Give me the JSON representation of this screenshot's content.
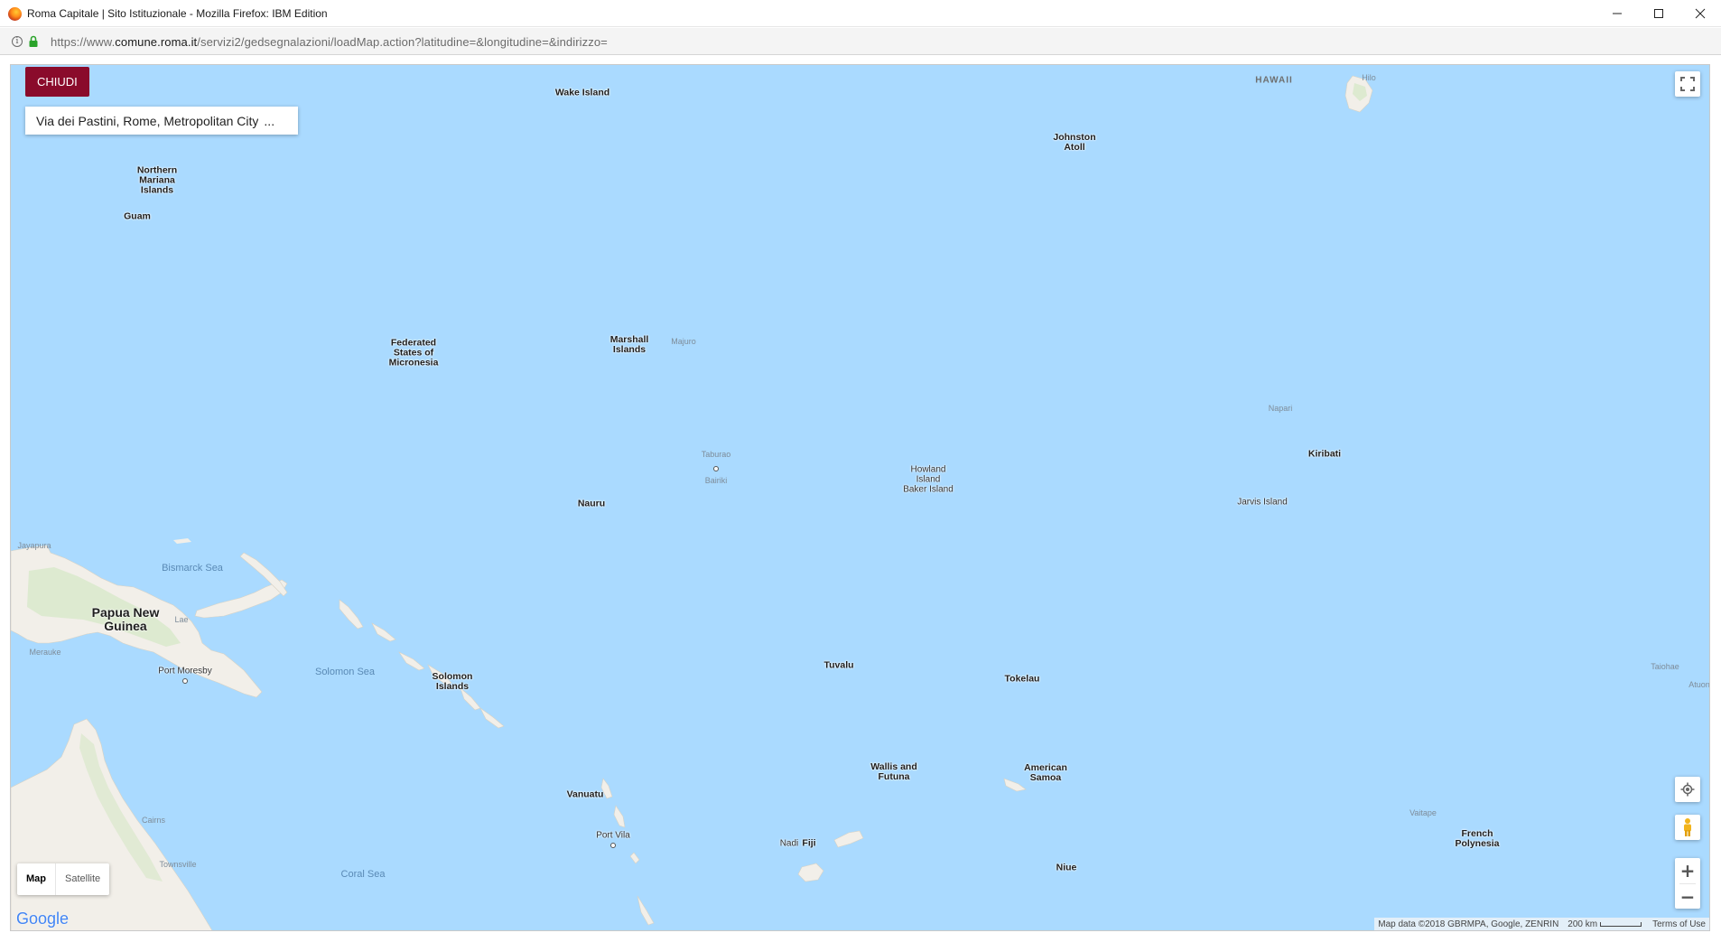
{
  "window": {
    "title": "Roma Capitale | Sito Istituzionale - Mozilla Firefox: IBM Edition"
  },
  "address_bar": {
    "url_prefix": "https://www.",
    "url_domain": "comune.roma.it",
    "url_path": "/servizi2/gedsegnalazioni/loadMap.action?latitudine=&longitudine=&indirizzo="
  },
  "toolbar": {
    "close_label": "CHIUDI",
    "address_text": "Via dei Pastini, Rome, Metropolitan City",
    "address_more": "..."
  },
  "map_type": {
    "map_label": "Map",
    "satellite_label": "Satellite"
  },
  "footer": {
    "google_logo": "Google",
    "map_data": "Map data ©2018 GBRMPA, Google, ZENRIN",
    "scale": "200 km",
    "terms": "Terms of Use"
  },
  "labels": {
    "wake_island": "Wake Island",
    "hawaii": "HAWAII",
    "hilo": "Hilo",
    "johnston_1": "Johnston",
    "johnston_2": "Atoll",
    "northern_mariana_1": "Northern",
    "northern_mariana_2": "Mariana",
    "northern_mariana_3": "Islands",
    "guam": "Guam",
    "fsm_1": "Federated",
    "fsm_2": "States of",
    "fsm_3": "Micronesia",
    "marshall_1": "Marshall",
    "marshall_2": "Islands",
    "majuro": "Majuro",
    "napari": "Napari",
    "kiribati": "Kiribati",
    "taburao": "Taburao",
    "bairiki": "Bairiki",
    "howland_1": "Howland",
    "howland_2": "Island",
    "baker": "Baker Island",
    "nauru": "Nauru",
    "jarvis": "Jarvis Island",
    "jayapura": "Jayapura",
    "bismarck_sea": "Bismarck Sea",
    "png_1": "Papua New",
    "png_2": "Guinea",
    "lae": "Lae",
    "merauke": "Merauke",
    "port_moresby": "Port Moresby",
    "solomon_sea": "Solomon Sea",
    "solomon_1": "Solomon",
    "solomon_2": "Islands",
    "tuvalu": "Tuvalu",
    "tokelau": "Tokelau",
    "taiohae": "Taiohae",
    "atuona": "Atuon",
    "wallis_1": "Wallis and",
    "wallis_2": "Futuna",
    "american_samoa_1": "American",
    "american_samoa_2": "Samoa",
    "vanuatu": "Vanuatu",
    "port_vila": "Port Vila",
    "nadi": "Nadi",
    "fiji": "Fiji",
    "vaitape": "Vaitape",
    "french_poly_1": "French",
    "french_poly_2": "Polynesia",
    "cairns": "Cairns",
    "townsville": "Townsville",
    "coral_sea": "Coral Sea",
    "niue": "Niue"
  },
  "colors": {
    "ocean": "#aadaff",
    "land": "#f2efe9",
    "vegetation": "#cfe6c0",
    "close_button": "#8a0b2b"
  },
  "icons": {
    "fullscreen": "fullscreen-icon",
    "location": "crosshair-icon",
    "pegman": "pegman-icon",
    "zoom_in": "plus-icon",
    "zoom_out": "minus-icon"
  }
}
